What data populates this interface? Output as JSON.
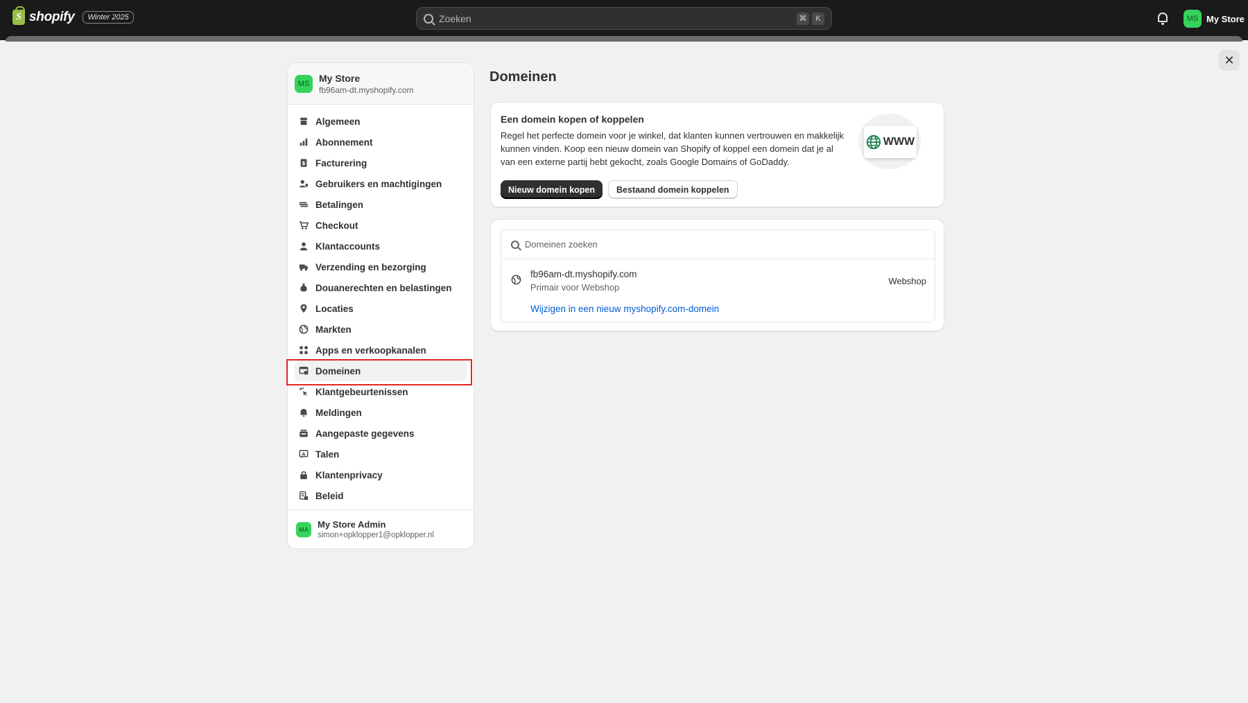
{
  "topbar": {
    "brand": "shopify",
    "edition": "Winter 2025",
    "search_placeholder": "Zoeken",
    "kbd_cmd": "⌘",
    "kbd_k": "K",
    "account_initials": "MS",
    "account_name": "My Store"
  },
  "close_label": "✕",
  "sidebar": {
    "store_initials": "MS",
    "store_name": "My Store",
    "store_url": "fb96am-dt.myshopify.com",
    "items": [
      {
        "label": "Algemeen",
        "icon": "store-icon"
      },
      {
        "label": "Abonnement",
        "icon": "plan-icon"
      },
      {
        "label": "Facturering",
        "icon": "billing-icon"
      },
      {
        "label": "Gebruikers en machtigingen",
        "icon": "users-icon"
      },
      {
        "label": "Betalingen",
        "icon": "payments-icon"
      },
      {
        "label": "Checkout",
        "icon": "cart-icon"
      },
      {
        "label": "Klantaccounts",
        "icon": "person-icon"
      },
      {
        "label": "Verzending en bezorging",
        "icon": "truck-icon"
      },
      {
        "label": "Douanerechten en belastingen",
        "icon": "tax-icon"
      },
      {
        "label": "Locaties",
        "icon": "location-icon"
      },
      {
        "label": "Markten",
        "icon": "globe-icon"
      },
      {
        "label": "Apps en verkoopkanalen",
        "icon": "apps-icon"
      },
      {
        "label": "Domeinen",
        "icon": "domains-icon"
      },
      {
        "label": "Klantgebeurtenissen",
        "icon": "events-icon"
      },
      {
        "label": "Meldingen",
        "icon": "bell-icon"
      },
      {
        "label": "Aangepaste gegevens",
        "icon": "data-icon"
      },
      {
        "label": "Talen",
        "icon": "language-icon"
      },
      {
        "label": "Klantenprivacy",
        "icon": "lock-icon"
      },
      {
        "label": "Beleid",
        "icon": "policy-icon"
      }
    ],
    "active_index": 12,
    "admin_initials": "MA",
    "admin_name": "My Store Admin",
    "admin_email": "simon+opklopper1@opklopper.nl"
  },
  "main": {
    "title": "Domeinen",
    "promo": {
      "title": "Een domein kopen of koppelen",
      "body": "Regel het perfecte domein voor je winkel, dat klanten kunnen vertrouwen en makkelijk kunnen vinden. Koop een nieuw domein van Shopify of koppel een domein dat je al van een externe partij hebt gekocht, zoals Google Domains of GoDaddy.",
      "primary_button": "Nieuw domein kopen",
      "secondary_button": "Bestaand domein koppelen",
      "illustration_text": "WWW"
    },
    "domains": {
      "search_placeholder": "Domeinen zoeken",
      "rows": [
        {
          "name": "fb96am-dt.myshopify.com",
          "subtitle": "Primair voor Webshop",
          "type": "Webshop",
          "link": "Wijzigen in een nieuw myshopify.com-domein"
        }
      ]
    }
  },
  "colors": {
    "topbar": "#1a1a1a",
    "avatar_green": "#36d35b",
    "link_blue": "#005bd3",
    "highlight_red": "#e02424"
  }
}
